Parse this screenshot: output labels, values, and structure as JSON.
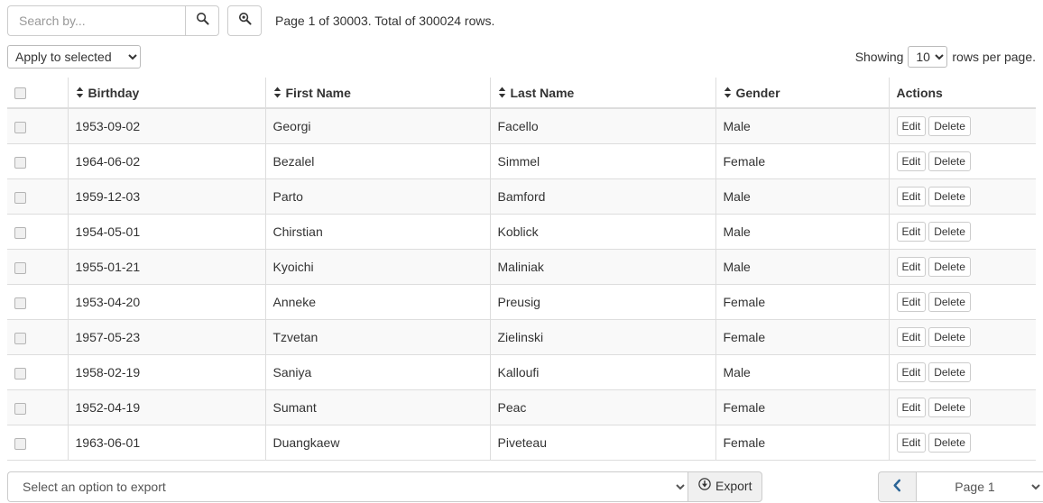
{
  "toolbar": {
    "search_placeholder": "Search by...",
    "search_value": "",
    "search_icon": "magnifier-icon",
    "advanced_search_icon": "magnifier-plus-icon",
    "page_info": "Page 1 of 30003. Total of 300024 rows."
  },
  "subbar": {
    "apply_to_selected_label": "Apply to selected",
    "apply_options": [
      "Apply to selected"
    ],
    "showing_prefix": "Showing",
    "rows_per_page_value": "10",
    "rows_per_page_options": [
      "10"
    ],
    "showing_suffix": "rows per page."
  },
  "table": {
    "sort_icon": "sort-icon",
    "columns": [
      {
        "key": "check",
        "label": "",
        "sortable": false
      },
      {
        "key": "bday",
        "label": "Birthday",
        "sortable": true
      },
      {
        "key": "first",
        "label": "First Name",
        "sortable": true
      },
      {
        "key": "last",
        "label": "Last Name",
        "sortable": true
      },
      {
        "key": "gender",
        "label": "Gender",
        "sortable": true
      },
      {
        "key": "act",
        "label": "Actions",
        "sortable": false
      }
    ],
    "actions": {
      "edit_label": "Edit",
      "delete_label": "Delete"
    },
    "rows": [
      {
        "birthday": "1953-09-02",
        "first_name": "Georgi",
        "last_name": "Facello",
        "gender": "Male"
      },
      {
        "birthday": "1964-06-02",
        "first_name": "Bezalel",
        "last_name": "Simmel",
        "gender": "Female"
      },
      {
        "birthday": "1959-12-03",
        "first_name": "Parto",
        "last_name": "Bamford",
        "gender": "Male"
      },
      {
        "birthday": "1954-05-01",
        "first_name": "Chirstian",
        "last_name": "Koblick",
        "gender": "Male"
      },
      {
        "birthday": "1955-01-21",
        "first_name": "Kyoichi",
        "last_name": "Maliniak",
        "gender": "Male"
      },
      {
        "birthday": "1953-04-20",
        "first_name": "Anneke",
        "last_name": "Preusig",
        "gender": "Female"
      },
      {
        "birthday": "1957-05-23",
        "first_name": "Tzvetan",
        "last_name": "Zielinski",
        "gender": "Female"
      },
      {
        "birthday": "1958-02-19",
        "first_name": "Saniya",
        "last_name": "Kalloufi",
        "gender": "Male"
      },
      {
        "birthday": "1952-04-19",
        "first_name": "Sumant",
        "last_name": "Peac",
        "gender": "Female"
      },
      {
        "birthday": "1963-06-01",
        "first_name": "Duangkaew",
        "last_name": "Piveteau",
        "gender": "Female"
      }
    ]
  },
  "bottombar": {
    "export_select_label": "Select an option to export",
    "export_options": [
      "Select an option to export"
    ],
    "export_button_label": "Export",
    "export_icon": "download-circle-icon",
    "prev_icon": "chevron-left-icon",
    "next_icon": "chevron-right-icon",
    "page_select_label": "Page 1",
    "page_options": [
      "Page 1"
    ]
  },
  "colors": {
    "accent": "#2a6496",
    "border": "#dddddd",
    "stripe": "#f9f9f9",
    "button_face": "#f0f0f0"
  }
}
